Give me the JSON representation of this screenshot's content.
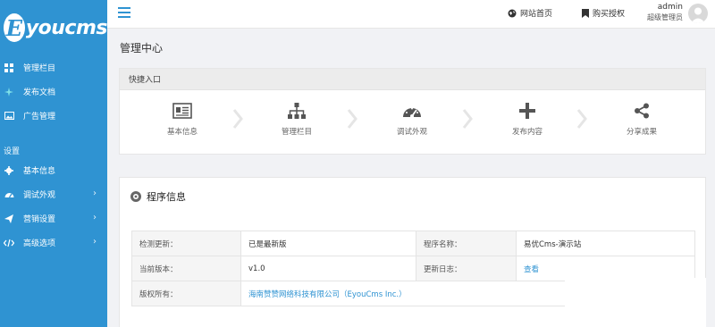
{
  "brand": {
    "logo_letter": "E",
    "logo_text": "youcms"
  },
  "sidebar": {
    "items": [
      {
        "label": "管理栏目",
        "icon": "grid-icon"
      },
      {
        "label": "发布文档",
        "icon": "plus-icon"
      },
      {
        "label": "广告管理",
        "icon": "image-icon"
      }
    ],
    "section_title": "设置",
    "settings_items": [
      {
        "label": "基本信息",
        "icon": "gear-icon",
        "has_arrow": false
      },
      {
        "label": "调试外观",
        "icon": "dashboard-icon",
        "has_arrow": true,
        "arrow": "›"
      },
      {
        "label": "营销设置",
        "icon": "send-icon",
        "has_arrow": true,
        "arrow": "›"
      },
      {
        "label": "高级选项",
        "icon": "code-icon",
        "has_arrow": true,
        "arrow": "›"
      }
    ]
  },
  "topbar": {
    "site_home": "网站首页",
    "buy_license": "购买授权",
    "username": "admin",
    "role": "超级管理员"
  },
  "page": {
    "title": "管理中心"
  },
  "quick_entry": {
    "title": "快捷入口",
    "items": [
      {
        "label": "基本信息",
        "icon": "id-card-icon"
      },
      {
        "label": "管理栏目",
        "icon": "sitemap-icon"
      },
      {
        "label": "调试外观",
        "icon": "dashboard-icon"
      },
      {
        "label": "发布内容",
        "icon": "plus-icon"
      },
      {
        "label": "分享成果",
        "icon": "share-icon"
      }
    ]
  },
  "program_info": {
    "title": "程序信息",
    "rows": [
      {
        "label1": "检测更新：",
        "value1": "已是最新版",
        "label2": "程序名称：",
        "value2": "易优Cms-演示站"
      },
      {
        "label1": "当前版本：",
        "value1": "v1.0",
        "label2": "更新日志：",
        "value2": "查看"
      },
      {
        "label1": "版权所有：",
        "value1": "海南赞赞网络科技有限公司（EyouCms Inc.）"
      }
    ]
  },
  "colors": {
    "primary": "#2f93d2",
    "background": "#f1f2f5"
  }
}
